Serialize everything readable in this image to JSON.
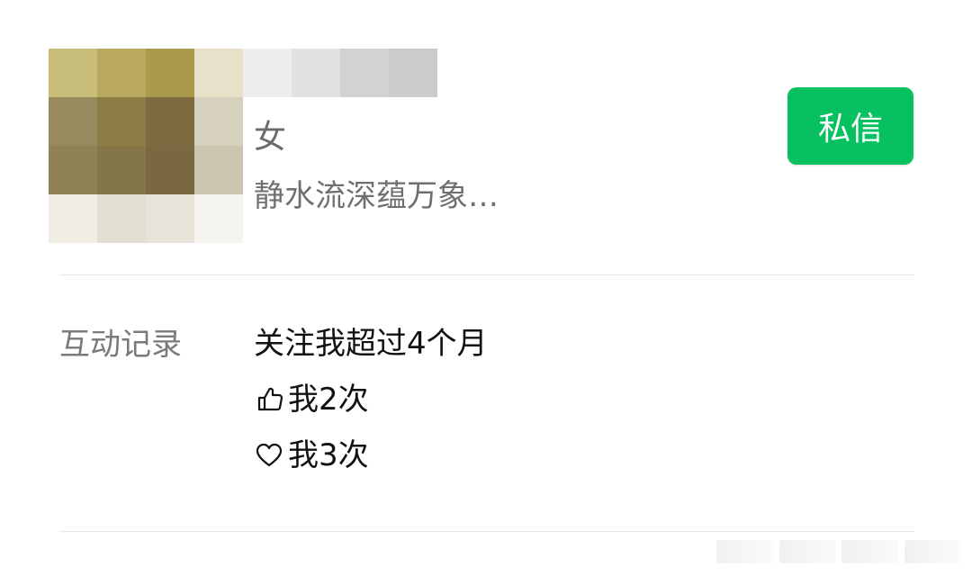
{
  "profile": {
    "gender": "女",
    "signature": "静水流深蕴万象…",
    "dm_button_label": "私信"
  },
  "interaction": {
    "section_label": "互动记录",
    "records": [
      {
        "icon": "none",
        "text": "关注我超过4个月"
      },
      {
        "icon": "thumbs-up-icon",
        "text": "我2次"
      },
      {
        "icon": "heart-icon",
        "text": "我3次"
      }
    ]
  },
  "colors": {
    "accent_green": "#07c160",
    "secondary_text": "#6f6f6f",
    "divider": "#e6e6e6"
  }
}
